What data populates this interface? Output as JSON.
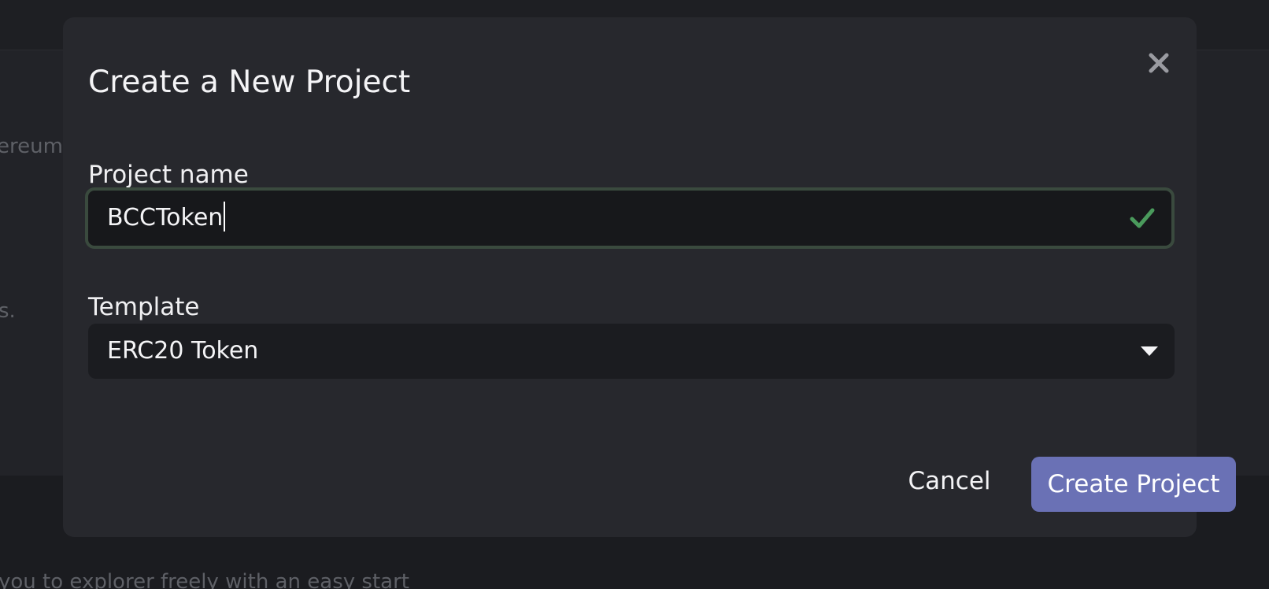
{
  "background": {
    "line1_text": "ereum",
    "line2_text": "s.",
    "line3_text": "you to explorer freely with an easy start"
  },
  "modal": {
    "title": "Create a New Project",
    "close_icon": "close-icon",
    "project_name": {
      "label": "Project name",
      "value": "BCCToken",
      "status_icon": "checkmark-icon",
      "status_color": "#4a9a5c"
    },
    "template": {
      "label": "Template",
      "selected": "ERC20 Token",
      "icon": "chevron-down-icon"
    },
    "actions": {
      "cancel_label": "Cancel",
      "create_label": "Create Project",
      "create_color": "#6a71b5"
    }
  }
}
